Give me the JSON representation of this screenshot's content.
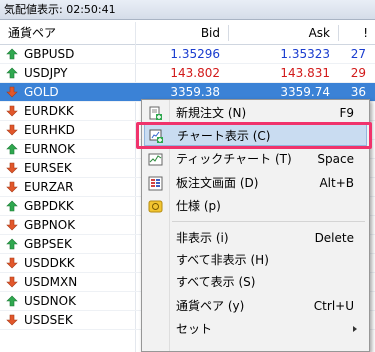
{
  "window": {
    "title": "気配値表示: 02:50:41"
  },
  "columns": {
    "pair": "通貨ペア",
    "bid": "Bid",
    "ask": "Ask",
    "spread": "!"
  },
  "rows": [
    {
      "symbol": "GBPUSD",
      "bid": "1.35296",
      "ask": "1.35323",
      "spread": "27",
      "dir": "up",
      "color": "blue"
    },
    {
      "symbol": "USDJPY",
      "bid": "143.802",
      "ask": "143.831",
      "spread": "29",
      "dir": "up",
      "color": "red"
    },
    {
      "symbol": "GOLD",
      "bid": "3359.38",
      "ask": "3359.74",
      "spread": "36",
      "dir": "down",
      "color": "none",
      "selected": true
    },
    {
      "symbol": "EURDKK",
      "dir": "down"
    },
    {
      "symbol": "EURHKD",
      "dir": "down"
    },
    {
      "symbol": "EURNOK",
      "dir": "up"
    },
    {
      "symbol": "EURSEK",
      "dir": "down"
    },
    {
      "symbol": "EURZAR",
      "dir": "down"
    },
    {
      "symbol": "GBPDKK",
      "dir": "up"
    },
    {
      "symbol": "GBPNOK",
      "dir": "down"
    },
    {
      "symbol": "GBPSEK",
      "dir": "up"
    },
    {
      "symbol": "USDDKK",
      "dir": "down"
    },
    {
      "symbol": "USDMXN",
      "dir": "down"
    },
    {
      "symbol": "USDNOK",
      "dir": "up"
    },
    {
      "symbol": "USDSEK",
      "dir": "down"
    }
  ],
  "context_menu": {
    "items": [
      {
        "label": "新規注文 (N)",
        "shortcut": "F9",
        "icon": "new-order-icon"
      },
      {
        "label": "チャート表示 (C)",
        "shortcut": "",
        "icon": "chart-window-icon",
        "highlighted": true
      },
      {
        "label": "ティックチャート (T)",
        "shortcut": "Space",
        "icon": "tick-chart-icon"
      },
      {
        "label": "板注文画面 (D)",
        "shortcut": "Alt+B",
        "icon": "depth-of-market-icon"
      },
      {
        "label": "仕様 (p)",
        "shortcut": "",
        "icon": "specification-icon"
      },
      {
        "label": "非表示 (i)",
        "shortcut": "Delete"
      },
      {
        "label": "すべて非表示 (H)",
        "shortcut": ""
      },
      {
        "label": "すべて表示 (S)",
        "shortcut": ""
      },
      {
        "label": "通貨ペア (y)",
        "shortcut": "Ctrl+U"
      },
      {
        "label": "セット",
        "shortcut": "",
        "submenu": true
      }
    ]
  },
  "colors": {
    "up": "#2fa84f",
    "down": "#e2572b",
    "selected_row": "#3b82d6",
    "highlight_frame": "#f0336c"
  }
}
